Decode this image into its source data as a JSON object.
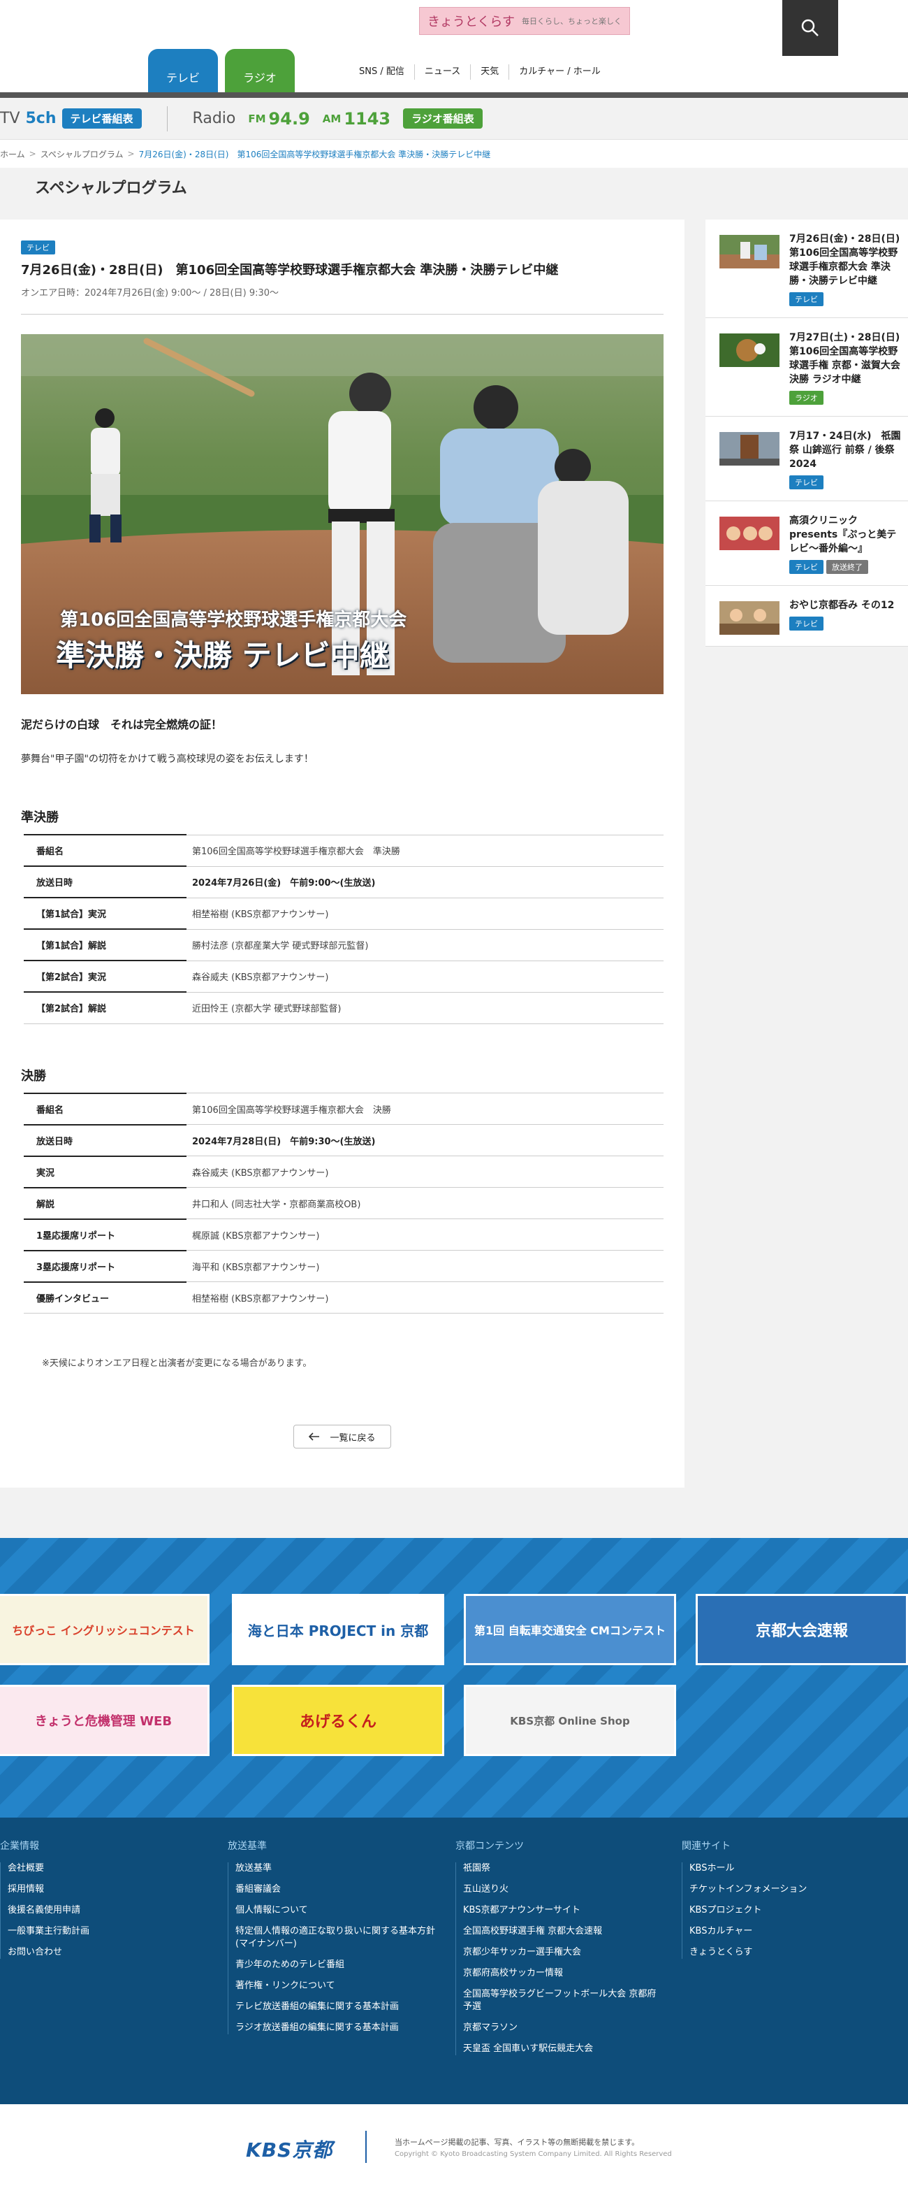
{
  "header": {
    "logo_text": "きょうとくらす",
    "logo_sub": "毎日くらし、ちょっと楽しく",
    "tabs": [
      {
        "label": "テレビ"
      },
      {
        "label": "ラジオ"
      }
    ],
    "nav": [
      "SNS / 配信",
      "ニュース",
      "天気",
      "カルチャー / ホール"
    ]
  },
  "channel_bar": {
    "tv_label": "TV",
    "tv_channel": "5ch",
    "tv_guide_label": "テレビ番組表",
    "radio_label": "Radio",
    "fm_prefix": "FM",
    "fm_freq": "94.9",
    "am_prefix": "AM",
    "am_freq": "1143",
    "radio_guide_label": "ラジオ番組表"
  },
  "breadcrumb": {
    "home": "ホーム",
    "section": "スペシャルプログラム",
    "dates": "7月26日(金)・28日(日)",
    "current": "第106回全国高等学校野球選手権京都大会 準決勝・決勝テレビ中継"
  },
  "page": {
    "title": "スペシャルプログラム"
  },
  "article": {
    "badge": "テレビ",
    "title": "7月26日(金)・28日(日)　第106回全国高等学校野球選手権京都大会 準決勝・決勝テレビ中継",
    "onair": "オンエア日時：2024年7月26日(金) 9:00〜 / 28日(日) 9:30〜",
    "hero_caption1": "第106回全国高等学校野球選手権京都大会",
    "hero_caption2": "準決勝・決勝 テレビ中継",
    "lead": "泥だらけの白球　それは完全燃焼の証！",
    "intro": "夢舞台\"甲子園\"の切符をかけて戦う高校球児の姿をお伝えします！",
    "semifinal": {
      "heading": "準決勝",
      "rows": [
        {
          "k": "番組名",
          "v": "第106回全国高等学校野球選手権京都大会　準決勝"
        },
        {
          "k": "放送日時",
          "v": "2024年7月26日(金)　午前9:00〜(生放送)"
        },
        {
          "k": "【第1試合】実況",
          "v": "相埜裕樹 (KBS京都アナウンサー)"
        },
        {
          "k": "【第1試合】解説",
          "v": "勝村法彦 (京都産業大学 硬式野球部元監督)"
        },
        {
          "k": "【第2試合】実況",
          "v": "森谷威夫 (KBS京都アナウンサー)"
        },
        {
          "k": "【第2試合】解説",
          "v": "近田怜王 (京都大学 硬式野球部監督)"
        }
      ]
    },
    "final": {
      "heading": "決勝",
      "rows": [
        {
          "k": "番組名",
          "v": "第106回全国高等学校野球選手権京都大会　決勝"
        },
        {
          "k": "放送日時",
          "v": "2024年7月28日(日)　午前9:30〜(生放送)"
        },
        {
          "k": "実況",
          "v": "森谷威夫 (KBS京都アナウンサー)"
        },
        {
          "k": "解説",
          "v": "井口和人 (同志社大学・京都商業高校OB)"
        },
        {
          "k": "1塁応援席リポート",
          "v": "梶原誠 (KBS京都アナウンサー)"
        },
        {
          "k": "3塁応援席リポート",
          "v": "海平和 (KBS京都アナウンサー)"
        },
        {
          "k": "優勝インタビュー",
          "v": "相埜裕樹 (KBS京都アナウンサー)"
        }
      ]
    },
    "note": "※天候によりオンエア日程と出演者が変更になる場合があります。",
    "back_label": "一覧に戻る"
  },
  "sidebar": [
    {
      "text": "7月26日(金)・28日(日)　第106回全国高等学校野球選手権京都大会 準決勝・決勝テレビ中継",
      "badges": [
        "テレビ"
      ]
    },
    {
      "text": "7月27日(土)・28日(日)　第106回全国高等学校野球選手権 京都・滋賀大会決勝 ラジオ中継",
      "badges": [
        "ラジオ"
      ]
    },
    {
      "text": "7月17・24日(水)　祇園祭 山鉾巡行 前祭 / 後祭 2024",
      "badges": [
        "テレビ"
      ]
    },
    {
      "text": "高須クリニック presents『ぷっと美テレビ〜番外編〜』",
      "badges": [
        "テレビ",
        "放送終了"
      ]
    },
    {
      "text": "おやじ京都呑み その12",
      "badges": [
        "テレビ"
      ]
    }
  ],
  "banners": [
    {
      "label": "ちびっこ イングリッシュコンテスト"
    },
    {
      "label": "海と日本 PROJECT in 京都"
    },
    {
      "label": "第1回 自転車交通安全 CMコンテスト"
    },
    {
      "label": "京都大会速報"
    },
    {
      "label": "きょうと危機管理 WEB"
    },
    {
      "label": "あげるくん"
    },
    {
      "label": "KBS京都 Online Shop"
    }
  ],
  "footer": {
    "columns": [
      {
        "heading": "企業情報",
        "items": [
          "会社概要",
          "採用情報",
          "後援名義使用申請",
          "一般事業主行動計画",
          "お問い合わせ"
        ]
      },
      {
        "heading": "放送基準",
        "items": [
          "放送基準",
          "番組審議会",
          "個人情報について",
          "特定個人情報の適正な取り扱いに関する基本方針(マイナンバー)",
          "青少年のためのテレビ番組",
          "著作権・リンクについて",
          "テレビ放送番組の編集に関する基本計画",
          "ラジオ放送番組の編集に関する基本計画"
        ]
      },
      {
        "heading": "京都コンテンツ",
        "items": [
          "祇園祭",
          "五山送り火",
          "KBS京都アナウンサーサイト",
          "全国高校野球選手権 京都大会速報",
          "京都少年サッカー選手権大会",
          "京都府高校サッカー情報",
          "全国高等学校ラグビーフットボール大会 京都府予選",
          "京都マラソン",
          "天皇盃 全国車いす駅伝競走大会"
        ]
      },
      {
        "heading": "関連サイト",
        "items": [
          "KBSホール",
          "チケットインフォメーション",
          "KBSプロジェクト",
          "KBSカルチャー",
          "きょうとくらす"
        ]
      }
    ]
  },
  "copyright": {
    "logo": "KBS京都",
    "line1": "当ホームページ掲載の記事、写真、イラスト等の無断掲載を禁じます。",
    "line2": "Copyright © Kyoto Broadcasting System Company Limited. All Rights Reserved"
  },
  "colors": {
    "tv_blue": "#1d7fc0",
    "radio_green": "#4da13a",
    "footer_navy": "#0e4d7a"
  }
}
